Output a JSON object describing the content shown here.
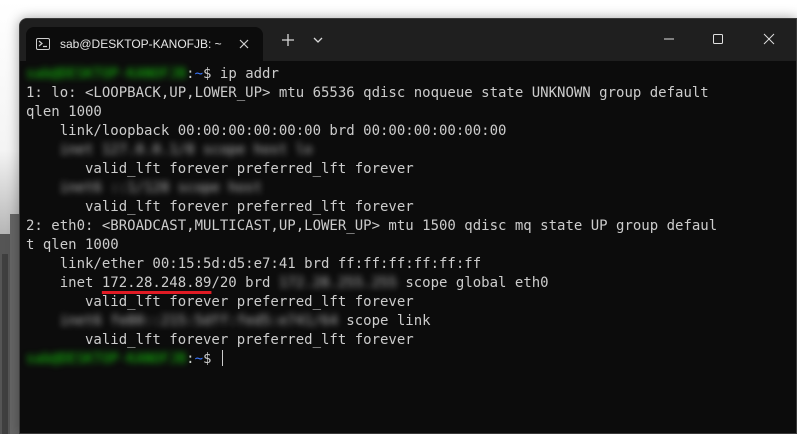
{
  "window": {
    "tab_title": "sab@DESKTOP-KANOFJB: ~",
    "tab_icon": "terminal-icon",
    "new_tab_icon": "plus-icon",
    "dropdown_icon": "chevron-down-icon",
    "minimize_icon": "minimize-icon",
    "maximize_icon": "maximize-icon",
    "close_icon": "close-icon"
  },
  "terminal": {
    "prompt_user": "sab@DESKTOP-KANOFJB",
    "prompt_path": "~",
    "prompt_symbol": "$",
    "command": "ip addr",
    "lines": {
      "lo_header": "1: lo: <LOOPBACK,UP,LOWER_UP> mtu 65536 qdisc noqueue state UNKNOWN group default",
      "lo_header_cont": "qlen 1000",
      "lo_link": "    link/loopback 00:00:00:00:00:00 brd 00:00:00:00:00:00",
      "lo_inet_blur": "inet 127.0.0.1/8 scope host lo",
      "lo_valid1": "       valid_lft forever preferred_lft forever",
      "lo_inet6_blur": "inet6 ::1/128 scope host",
      "lo_valid2": "       valid_lft forever preferred_lft forever",
      "eth0_header": "2: eth0: <BROADCAST,MULTICAST,UP,LOWER_UP> mtu 1500 qdisc mq state UP group defaul",
      "eth0_header_cont": "t qlen 1000",
      "eth0_link": "    link/ether 00:15:5d:d5:e7:41 brd ff:ff:ff:ff:ff:ff",
      "eth0_inet_prefix": "    inet ",
      "eth0_inet_ip": "172.28.248.89",
      "eth0_inet_mask": "/20 brd ",
      "eth0_inet_brd_blur": "172.28.255.255",
      "eth0_inet_suffix": " scope global eth0",
      "eth0_valid1": "       valid_lft forever preferred_lft forever",
      "eth0_inet6_blur": "inet6 fe80::215:5dff:fed5:e741/64",
      "eth0_inet6_suffix": " scope link",
      "eth0_valid2": "       valid_lft forever preferred_lft forever"
    }
  }
}
